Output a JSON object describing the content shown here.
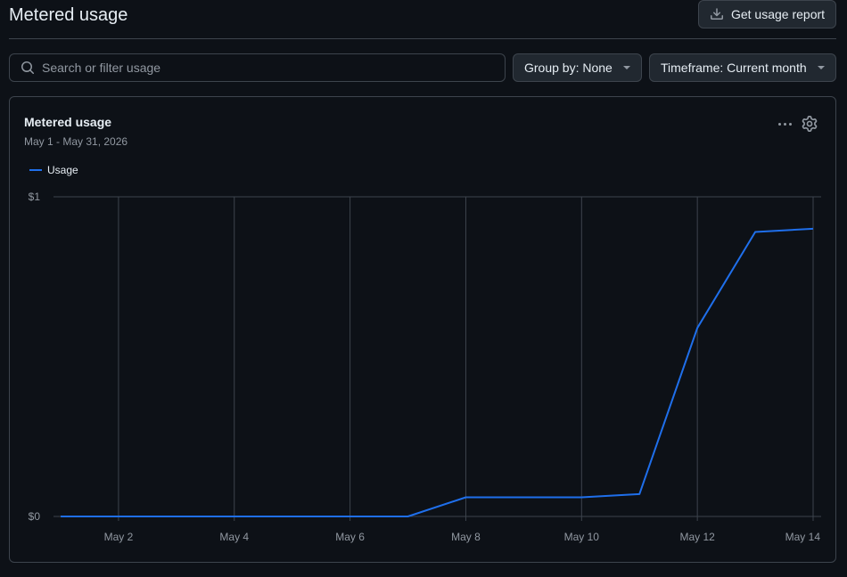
{
  "page": {
    "title": "Metered usage"
  },
  "toolbar": {
    "report_label": "Get usage report",
    "search_placeholder": "Search or filter usage",
    "group_by": "Group by: None",
    "timeframe": "Timeframe: Current month"
  },
  "card": {
    "title": "Metered usage",
    "subtitle": "May 1 - May 31, 2026",
    "legend_label": "Usage"
  },
  "colors": {
    "accent": "#1f6feb",
    "background": "#0d1117",
    "border": "#3d444d"
  },
  "chart_data": {
    "type": "line",
    "x": [
      "May 1",
      "May 2",
      "May 3",
      "May 4",
      "May 5",
      "May 6",
      "May 7",
      "May 8",
      "May 9",
      "May 10",
      "May 11",
      "May 12",
      "May 13",
      "May 14"
    ],
    "series": [
      {
        "name": "Usage",
        "values": [
          0,
          0,
          0,
          0,
          0,
          0,
          0,
          0.06,
          0.06,
          0.06,
          0.07,
          0.59,
          0.89,
          0.9
        ]
      }
    ],
    "x_tick_labels": [
      "May 2",
      "May 4",
      "May 6",
      "May 8",
      "May 10",
      "May 12",
      "May 14"
    ],
    "y_tick_labels": [
      "$0",
      "$1"
    ],
    "ylim": [
      0,
      1
    ],
    "grid": true,
    "legend": "top-left"
  }
}
